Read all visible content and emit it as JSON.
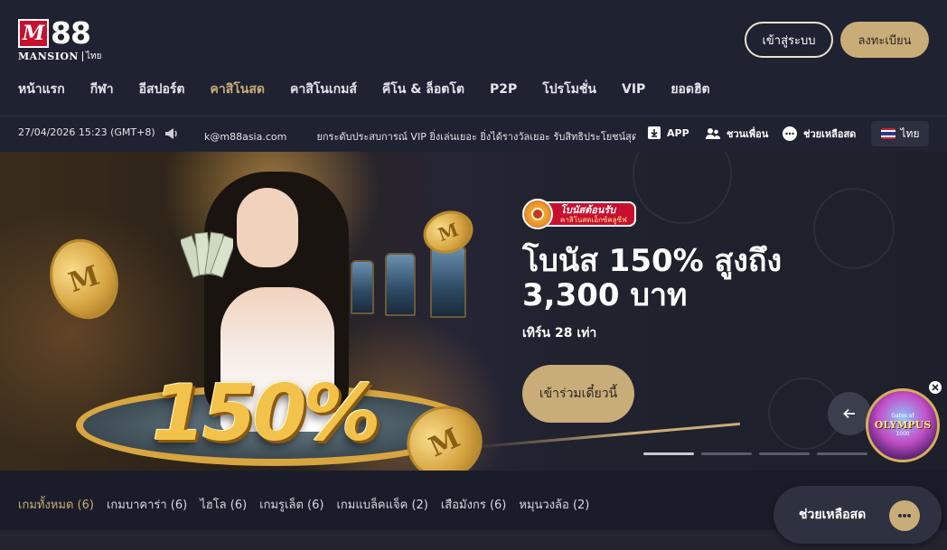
{
  "header": {
    "logo": {
      "brand": "88",
      "sub": "MANSION",
      "region": "ไทย",
      "letter": "M"
    },
    "login_label": "เข้าสู่ระบบ",
    "register_label": "ลงทะเบียน"
  },
  "nav": {
    "items": [
      {
        "label": "หน้าแรก",
        "active": false
      },
      {
        "label": "กีฬา",
        "active": false
      },
      {
        "label": "อีสปอร์ต",
        "active": false
      },
      {
        "label": "คาสิโนสด",
        "active": true
      },
      {
        "label": "คาสิโนเกมส์",
        "active": false
      },
      {
        "label": "คีโน & ล็อตโต",
        "active": false
      },
      {
        "label": "P2P",
        "active": false
      },
      {
        "label": "โปรโมชั่น",
        "active": false
      },
      {
        "label": "VIP",
        "active": false
      },
      {
        "label": "ยอดฮิต",
        "active": false
      }
    ]
  },
  "infobar": {
    "datetime": "27/04/2026 15:23 (GMT+8)",
    "marquee_email": "k@m88asia.com",
    "marquee_text": "ยกระดับประสบการณ์ VIP ยิ่งเล่นเยอะ ยิ่งได้รางวัลเยอะ รับสิทธิประโยชน์สุดพิเศษ",
    "app_label": "APP",
    "invite_label": "ชวนเพื่อน",
    "help_label": "ช่วยเหลือสด",
    "language": "ไทย"
  },
  "banner": {
    "badge_title": "โบนัสต้อนรับ",
    "badge_sub": "คาสิโนสดเอ็กซ์คลูซีฟ",
    "badge_icon_text": "WELCOME",
    "promo_title": "โบนัส 150% สูงถึง 3,300 บาท",
    "promo_sub": "เทิร์น 28 เท่า",
    "join_label": "เข้าร่วมเดี๋ยวนี้",
    "big_number": "150%",
    "coin_text": "M",
    "slide_count": 4,
    "active_slide": 0
  },
  "olympus": {
    "title": "OLYMPUS",
    "top": "Gates of",
    "sub": "1000"
  },
  "tabs": {
    "items": [
      {
        "label": "เกมทั้งหมด (6)",
        "active": true
      },
      {
        "label": "เกมบาคาร่า (6)",
        "active": false
      },
      {
        "label": "ไฮโล (6)",
        "active": false
      },
      {
        "label": "เกมรูเล็ต (6)",
        "active": false
      },
      {
        "label": "เกมแบล็คแจ็ค (2)",
        "active": false
      },
      {
        "label": "เสือมังกร (6)",
        "active": false
      },
      {
        "label": "หมุนวงล้อ (2)",
        "active": false
      }
    ]
  },
  "help_float": {
    "label": "ช่วยเหลือสด"
  },
  "colors": {
    "accent_gold": "#c9ad78",
    "background": "#1a1d29",
    "header_bg": "#1f2230",
    "brand_red": "#c8102e"
  },
  "icons": [
    "megaphone-icon",
    "download-icon",
    "users-icon",
    "chat-icon",
    "thai-flag-icon",
    "arrow-left-icon",
    "close-icon",
    "chat-bubble-icon"
  ]
}
